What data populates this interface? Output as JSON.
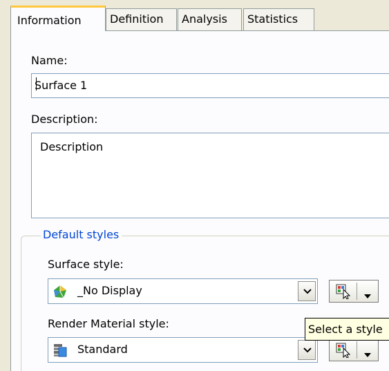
{
  "tabs": [
    {
      "label": "Information",
      "active": true
    },
    {
      "label": "Definition",
      "active": false
    },
    {
      "label": "Analysis",
      "active": false
    },
    {
      "label": "Statistics",
      "active": false
    }
  ],
  "name": {
    "label": "Name:",
    "value": "Surface 1"
  },
  "description": {
    "label": "Description:",
    "value": "Description"
  },
  "default_styles": {
    "legend": "Default styles",
    "surface_style": {
      "label": "Surface style:",
      "value": "_No Display",
      "icon": "surface-style-icon"
    },
    "render_material_style": {
      "label": "Render Material style:",
      "value": "Standard",
      "icon": "render-material-icon"
    }
  },
  "tooltip": {
    "text": "Select a style"
  },
  "colors": {
    "active_tab_accent": "#FFC83C",
    "legend_text": "#0046D5",
    "tooltip_bg": "#FFFFE1"
  }
}
